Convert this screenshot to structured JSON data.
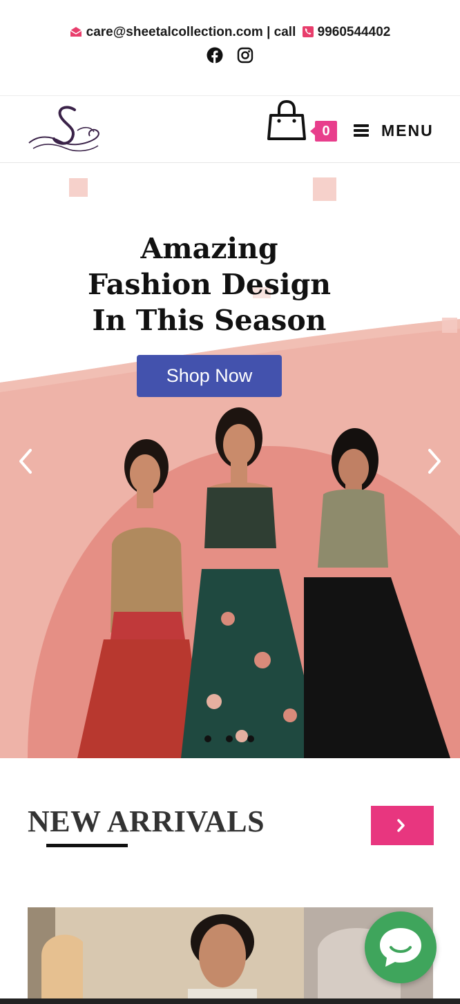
{
  "topbar": {
    "email": "care@sheetalcollection.com",
    "separator": " | ",
    "call_label": "call",
    "phone": "9960544402",
    "email_icon": "envelope-open-icon",
    "phone_icon": "phone-icon",
    "social": [
      "facebook-icon",
      "instagram-icon"
    ]
  },
  "header": {
    "logo_icon": "swan-s-logo",
    "cart_icon": "shopping-bag-icon",
    "cart_count": "0",
    "menu_label": "MENU",
    "menu_icon": "hamburger-icon"
  },
  "hero": {
    "title_line1": "Amazing",
    "title_line2": "Fashion Design",
    "title_line3": "In This Season",
    "cta_label": "Shop Now",
    "prev_icon": "chevron-left-icon",
    "next_icon": "chevron-right-icon",
    "slides": 3,
    "active_slide": 1
  },
  "arrivals": {
    "title": "NEW ARRIVALS",
    "next_icon": "chevron-right-icon"
  },
  "chat": {
    "icon": "chat-bubble-icon"
  },
  "colors": {
    "accent_pink": "#e83e8c",
    "cta_blue": "#4352ad",
    "hero_pink": "#eeb3a8",
    "hero_circle": "#e58f85",
    "chat_green": "#3fa55c"
  }
}
